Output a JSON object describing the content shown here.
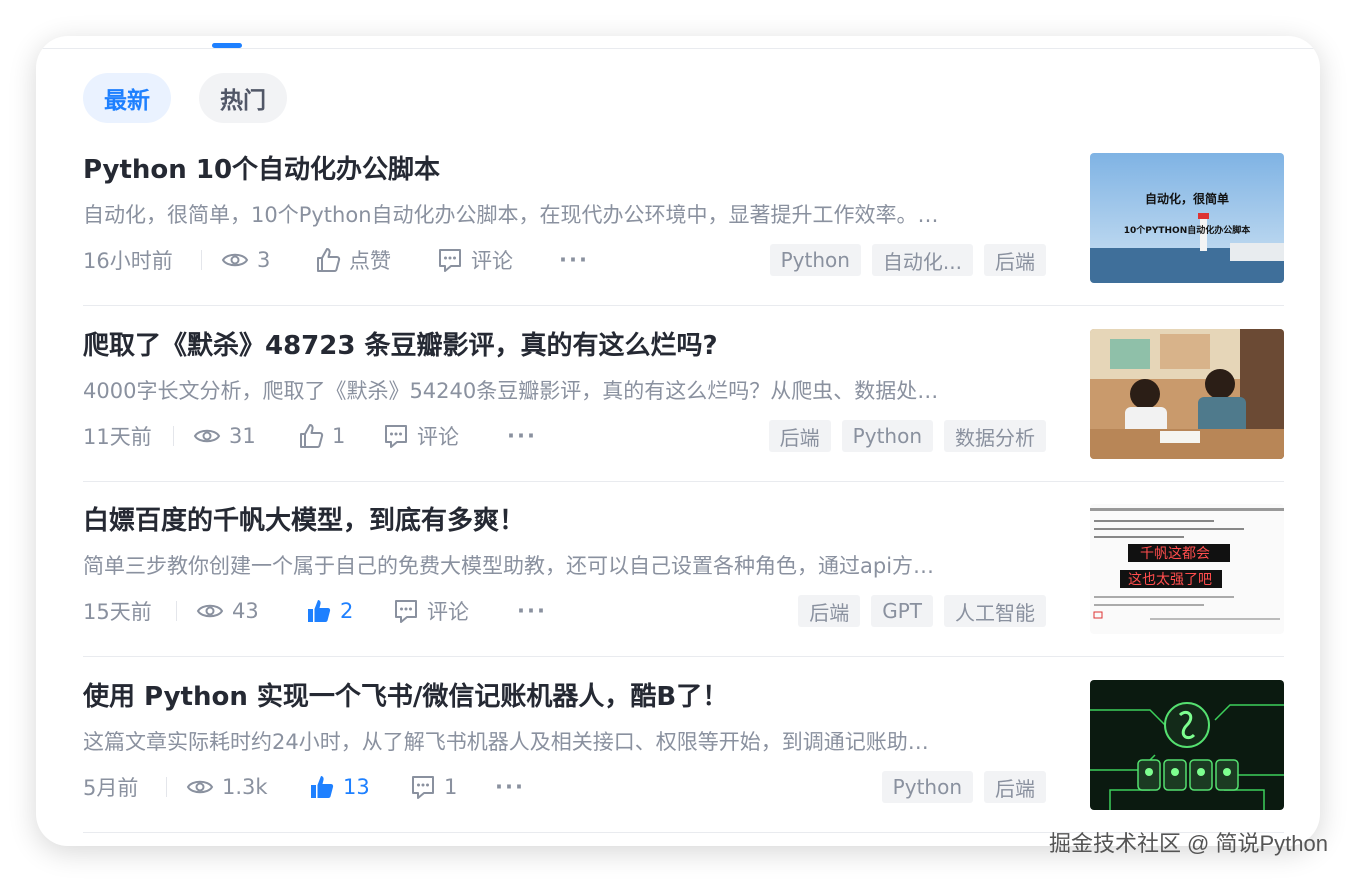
{
  "filters": {
    "latest": "最新",
    "hot": "热门"
  },
  "articles": [
    {
      "title": "Python 10个自动化办公脚本",
      "abstract": "自动化，很简单，10个Python自动化办公脚本，在现代办公环境中，显著提升工作效率。…",
      "time": "16小时前",
      "views": "3",
      "like": "点赞",
      "comment": "评论",
      "tags": [
        "Python",
        "自动化...",
        "后端"
      ],
      "thumb_text": [
        "自动化，很简单",
        "10个PYTHON自动化办公脚本"
      ]
    },
    {
      "title": "爬取了《默杀》48723 条豆瓣影评，真的有这么烂吗?",
      "abstract": "4000字长文分析，爬取了《默杀》54240条豆瓣影评，真的有这么烂吗？从爬虫、数据处…",
      "time": "11天前",
      "views": "31",
      "like": "1",
      "comment": "评论",
      "tags": [
        "后端",
        "Python",
        "数据分析"
      ]
    },
    {
      "title": "白嫖百度的千帆大模型，到底有多爽！",
      "abstract": "简单三步教你创建一个属于自己的免费大模型助教，还可以自己设置各种角色，通过api方…",
      "time": "15天前",
      "views": "43",
      "like": "2",
      "comment": "评论",
      "tags": [
        "后端",
        "GPT",
        "人工智能"
      ],
      "thumb_text": [
        "千帆这都会",
        "这也太强了吧"
      ]
    },
    {
      "title": "使用 Python 实现一个飞书/微信记账机器人，酷B了！",
      "abstract": "这篇文章实际耗时约24小时，从了解飞书机器人及相关接口、权限等开始，到调通记账助…",
      "time": "5月前",
      "views": "1.3k",
      "like": "13",
      "comment": "1",
      "tags": [
        "Python",
        "后端"
      ]
    }
  ],
  "more": "···",
  "watermark": "掘金技术社区 @ 简说Python",
  "colors": {
    "accent": "#1e80ff",
    "title": "#252933",
    "muted": "#8a919f",
    "tag_bg": "#f2f3f5"
  }
}
